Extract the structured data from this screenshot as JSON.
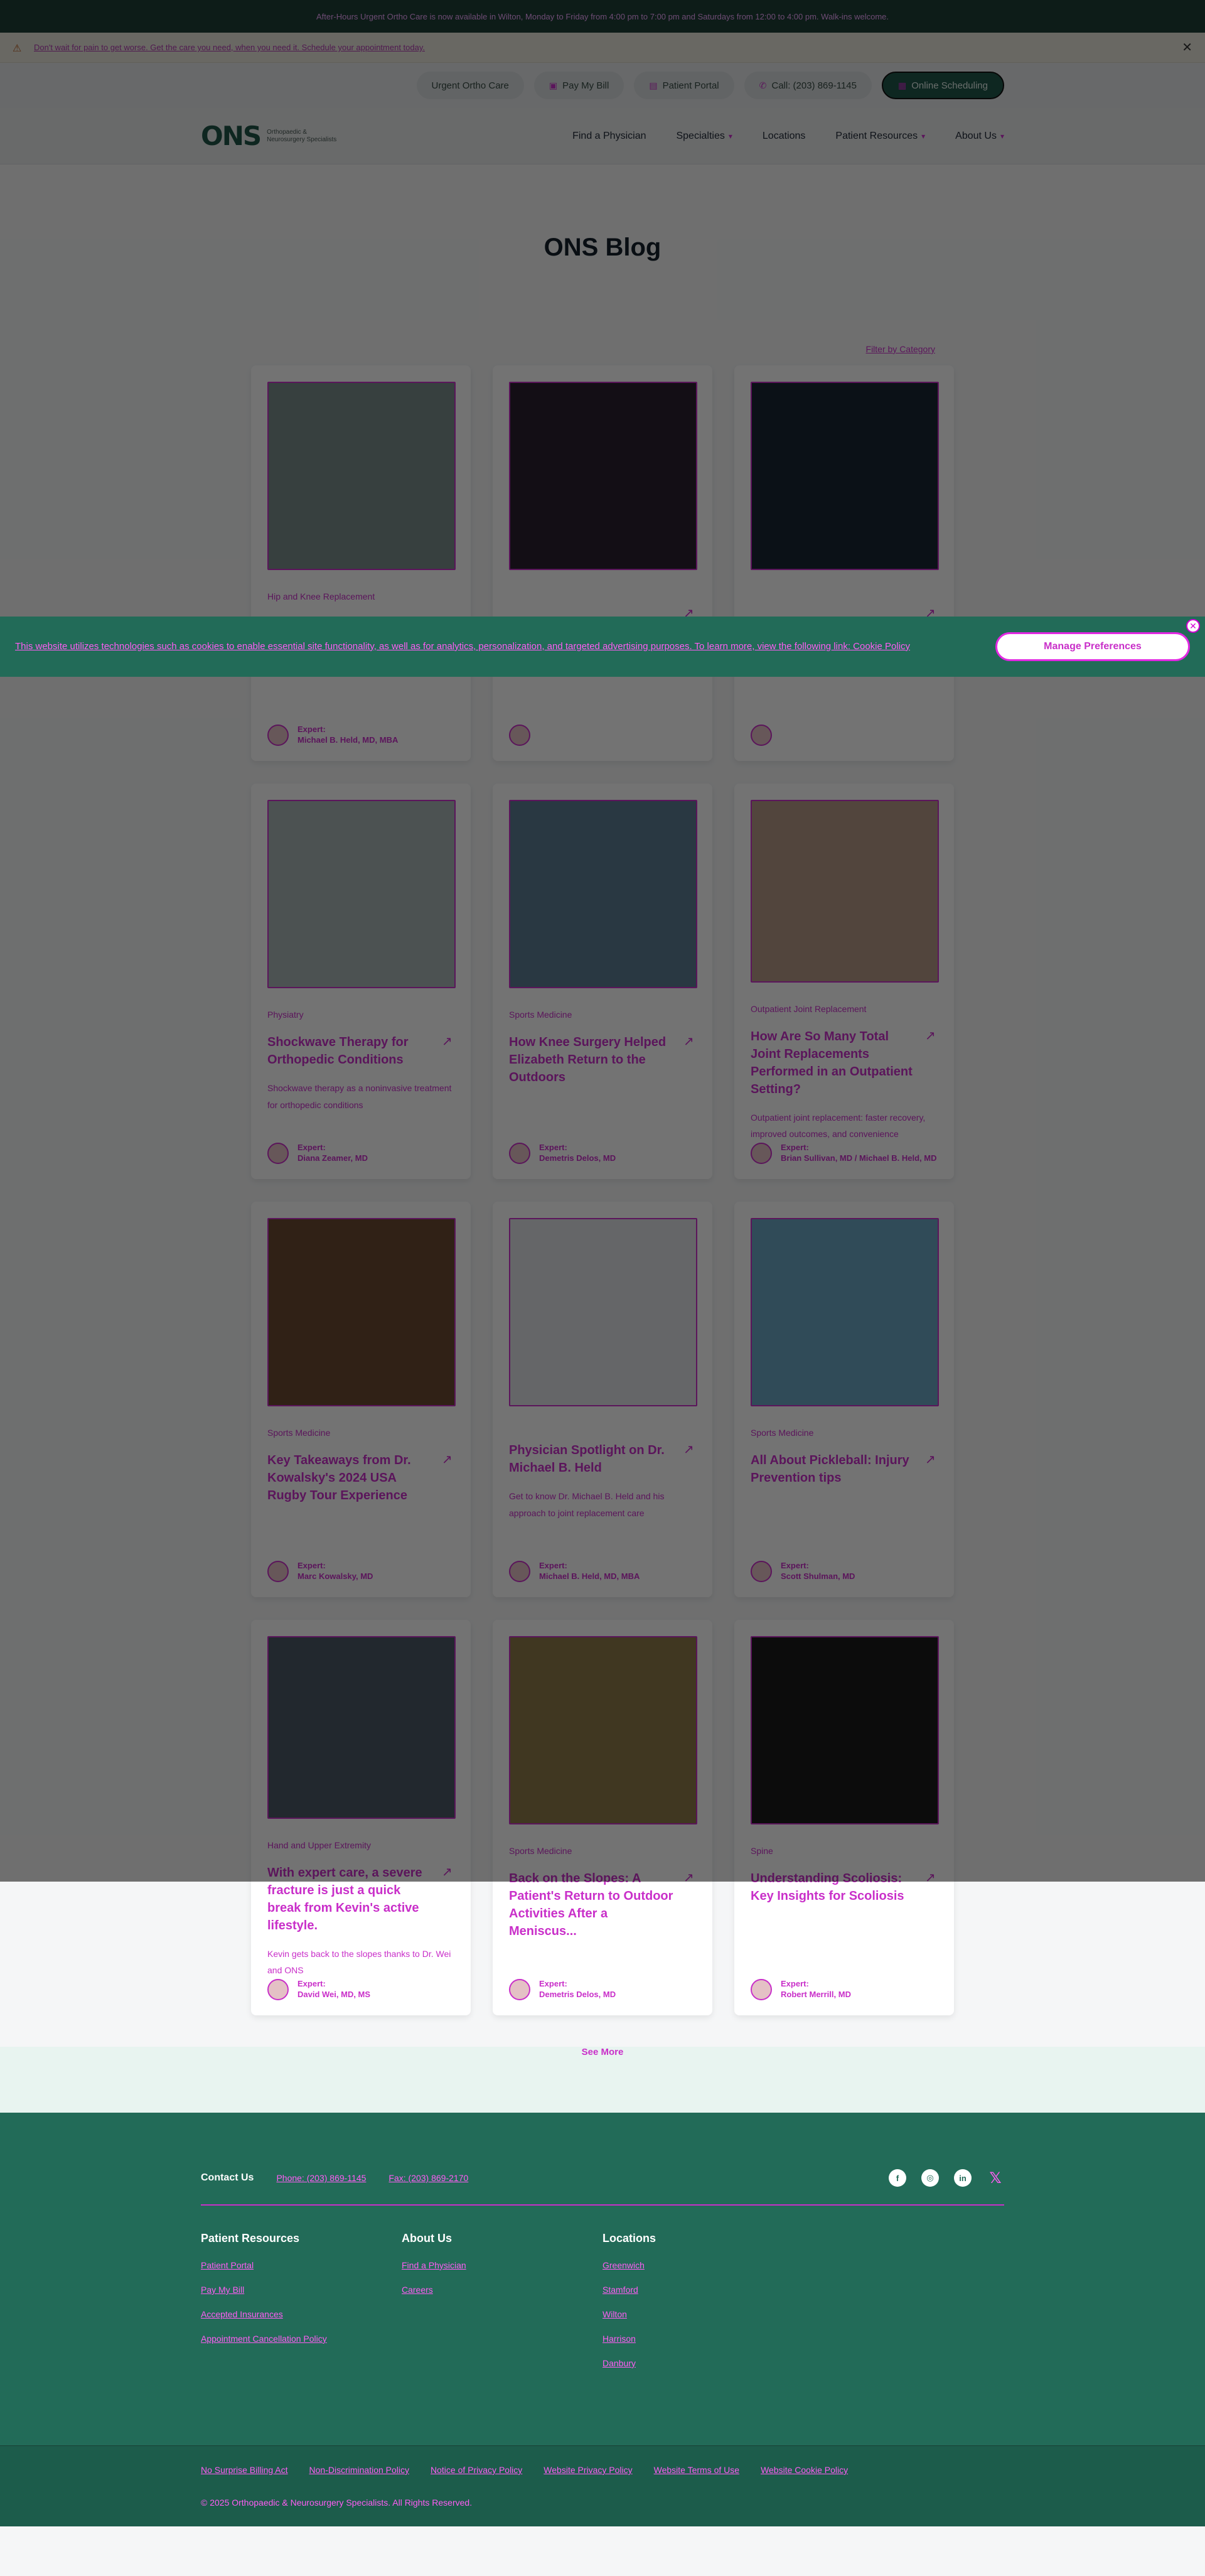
{
  "topbar": {
    "message": "After-Hours Urgent Ortho Care is now available in Wilton, Monday to Friday from 4:00 pm to 7:00 pm and Saturdays from 12:00 to 4:00 pm. Walk-ins welcome."
  },
  "alert": {
    "message": "Don't wait for pain to get worse. Get the care you need, when you need it. Schedule your appointment today."
  },
  "utility": {
    "urgent": "Urgent Ortho Care",
    "paybill": "Pay My Bill",
    "portal": "Patient Portal",
    "call": "Call: (203) 869-1145",
    "scheduling": "Online Scheduling"
  },
  "nav": {
    "logo": "ONS",
    "logo_sub": "Orthopaedic & Neurosurgery Specialists",
    "find": "Find a Physician",
    "specialties": "Specialties",
    "locations": "Locations",
    "patient_resources": "Patient Resources",
    "about": "About Us"
  },
  "page": {
    "title": "ONS Blog",
    "filter": "Filter by Category"
  },
  "cookie": {
    "text": "This website utilizes technologies such as cookies to enable essential site functionality, as well as for analytics, personalization, and targeted advertising purposes. To learn more, view the following link: Cookie Policy",
    "button": "Manage Preferences"
  },
  "cards": [
    {
      "cat": "Hip and Knee Replacement",
      "title": "",
      "excerpt": "",
      "expert_label": "Expert:",
      "expert": "Michael B. Held, MD, MBA"
    },
    {
      "cat": "",
      "title": "",
      "excerpt": "",
      "expert_label": "",
      "expert": ""
    },
    {
      "cat": "",
      "title": "",
      "excerpt": "",
      "expert_label": "",
      "expert": ""
    },
    {
      "cat": "Physiatry",
      "title": "Shockwave Therapy for Orthopedic Conditions",
      "excerpt": "Shockwave therapy as a noninvasive treatment for orthopedic conditions",
      "expert_label": "Expert:",
      "expert": "Diana Zeamer, MD"
    },
    {
      "cat": "Sports Medicine",
      "title": "How Knee Surgery Helped Elizabeth Return to the Outdoors",
      "excerpt": "",
      "expert_label": "Expert:",
      "expert": "Demetris Delos, MD"
    },
    {
      "cat": "Outpatient Joint Replacement",
      "title": "How Are So Many Total Joint Replacements Performed in an Outpatient Setting?",
      "excerpt": "Outpatient joint replacement: faster recovery, improved outcomes, and convenience",
      "expert_label": "Expert:",
      "expert": "Brian Sullivan, MD / Michael B. Held, MD"
    },
    {
      "cat": "Sports Medicine",
      "title": "Key Takeaways from Dr. Kowalsky's 2024 USA Rugby Tour Experience",
      "excerpt": "",
      "expert_label": "Expert:",
      "expert": "Marc Kowalsky, MD"
    },
    {
      "cat": "",
      "title": "Physician Spotlight on Dr. Michael B. Held",
      "excerpt": "Get to know Dr. Michael B. Held and his approach to joint replacement care",
      "expert_label": "Expert:",
      "expert": "Michael B. Held, MD, MBA"
    },
    {
      "cat": "Sports Medicine",
      "title": "All About Pickleball: Injury Prevention tips",
      "excerpt": "",
      "expert_label": "Expert:",
      "expert": "Scott Shulman, MD"
    },
    {
      "cat": "Hand and Upper Extremity",
      "title": "With expert care, a severe fracture is just a quick break from Kevin's active lifestyle.",
      "excerpt": "Kevin gets back to the slopes thanks to Dr. Wei and ONS",
      "expert_label": "Expert:",
      "expert": "David Wei, MD, MS"
    },
    {
      "cat": "Sports Medicine",
      "title": "Back on the Slopes: A Patient's Return to Outdoor Activities After a Meniscus...",
      "excerpt": "",
      "expert_label": "Expert:",
      "expert": "Demetris Delos, MD"
    },
    {
      "cat": "Spine",
      "title": "Understanding Scoliosis: Key Insights for Scoliosis",
      "excerpt": "",
      "expert_label": "Expert:",
      "expert": "Robert Merrill, MD"
    }
  ],
  "see_more": "See More",
  "footer": {
    "contact": "Contact Us",
    "phone": "Phone: (203) 869-1145",
    "fax": "Fax: (203) 869-2170",
    "col1_h": "Patient Resources",
    "col1": [
      "Patient Portal",
      "Pay My Bill",
      "Accepted Insurances",
      "Appointment Cancellation Policy"
    ],
    "col2_h": "About Us",
    "col2": [
      "Find a Physician",
      "Careers"
    ],
    "col3_h": "Locations",
    "col3": [
      "Greenwich",
      "Stamford",
      "Wilton",
      "Harrison",
      "Danbury"
    ],
    "legal": [
      "No Surprise Billing Act",
      "Non-Discrimination Policy",
      "Notice of Privacy Policy",
      "Website Privacy Policy",
      "Website Terms of Use",
      "Website Cookie Policy"
    ],
    "copyright": "© 2025 Orthopaedic & Neurosurgery Specialists. All Rights Reserved."
  }
}
